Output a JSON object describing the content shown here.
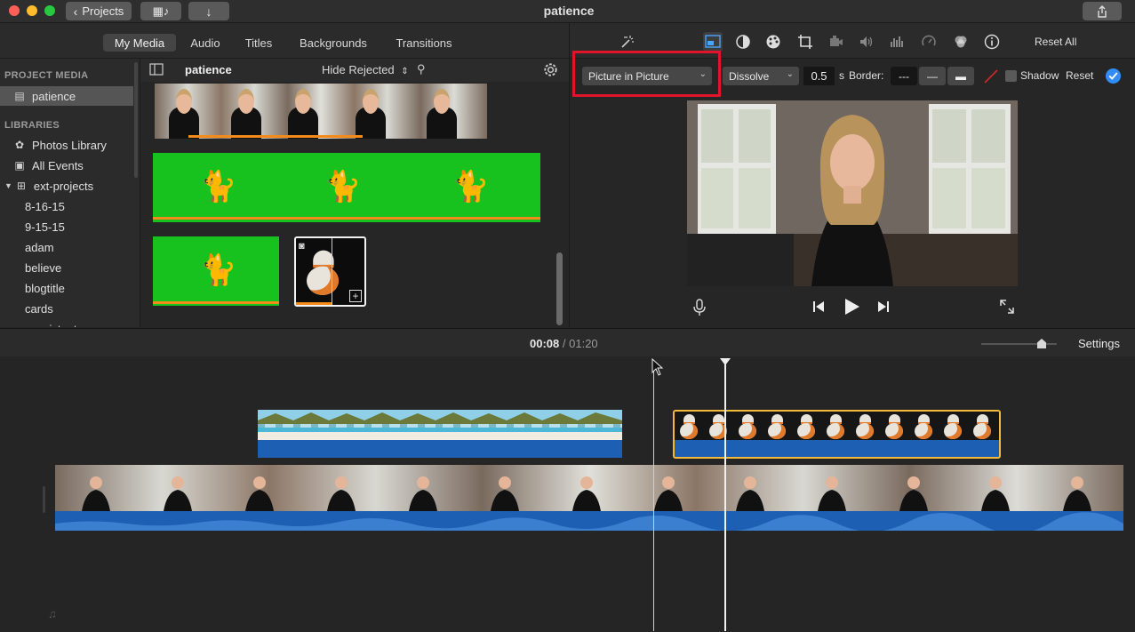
{
  "window": {
    "title": "patience",
    "back_button": "Projects"
  },
  "tabs": [
    "My Media",
    "Audio",
    "Titles",
    "Backgrounds",
    "Transitions"
  ],
  "sidebar": {
    "project_media_header": "PROJECT MEDIA",
    "project_item": "patience",
    "libraries_header": "LIBRARIES",
    "items": [
      "Photos Library",
      "All Events",
      "ext-projects",
      "8-16-15",
      "9-15-15",
      "adam",
      "believe",
      "blogtitle",
      "cards",
      "consistent"
    ]
  },
  "browser": {
    "library_label": "patience",
    "filter": "Hide Rejected",
    "search_placeholder": ""
  },
  "viewer": {
    "overlay_mode": "Picture in Picture",
    "transition": "Dissolve",
    "duration": "0.5",
    "duration_unit": "s",
    "border_label": "Border:",
    "border_opt1": "---",
    "border_opt2": "—",
    "border_opt3": "▬",
    "shadow_label": "Shadow",
    "reset_label": "Reset",
    "reset_all": "Reset All"
  },
  "timeline": {
    "current": "00:08",
    "separator": "/",
    "total": "01:20",
    "settings_label": "Settings"
  },
  "colors": {
    "accent": "#2f8df5",
    "highlight_red": "#e0142a",
    "selected_clip": "#f3b93a",
    "audio_blue": "#1d5fb2",
    "green_screen": "#17c21f"
  }
}
